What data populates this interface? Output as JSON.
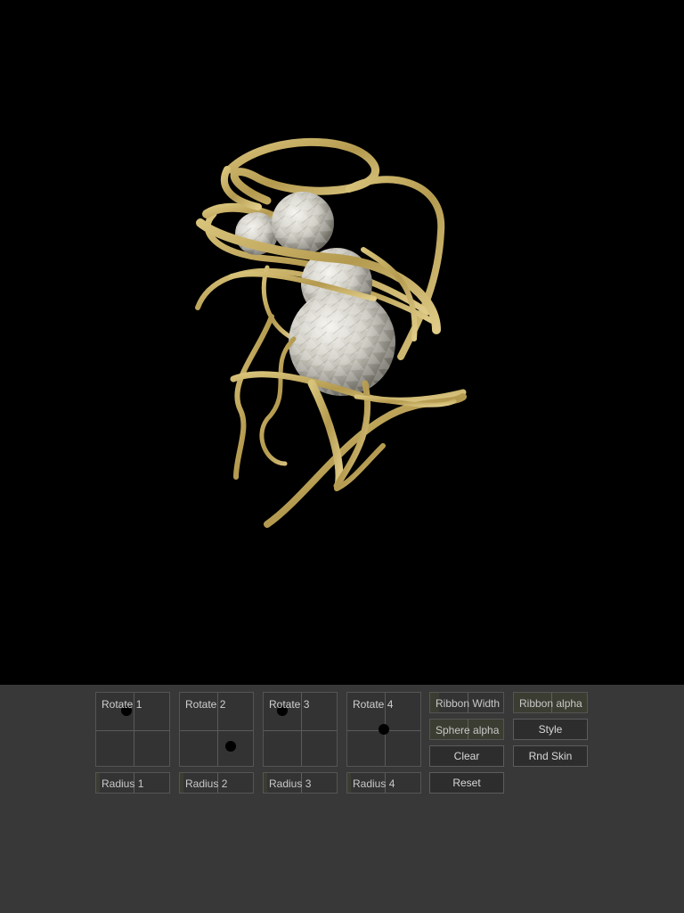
{
  "controls": {
    "pads": [
      {
        "label": "Rotate 1",
        "handle": [
          0.42,
          0.24
        ]
      },
      {
        "label": "Rotate 2",
        "handle": [
          0.7,
          0.73
        ]
      },
      {
        "label": "Rotate 3",
        "handle": [
          0.26,
          0.24
        ]
      },
      {
        "label": "Rotate 4",
        "handle": [
          0.5,
          0.5
        ]
      }
    ],
    "sliders": {
      "radius_1": {
        "label": "Radius 1",
        "value": 0.05
      },
      "radius_2": {
        "label": "Radius 2",
        "value": 0.05
      },
      "radius_3": {
        "label": "Radius 3",
        "value": 0.05
      },
      "radius_4": {
        "label": "Radius 4",
        "value": 0.05
      },
      "ribbon_width": {
        "label": "Ribbon Width",
        "value": 0.12
      },
      "ribbon_alpha": {
        "label": "Ribbon alpha",
        "value": 1.0
      },
      "sphere_alpha": {
        "label": "Sphere alpha",
        "value": 1.0
      }
    },
    "buttons": {
      "style": "Style",
      "clear": "Clear",
      "rnd_skin": "Rnd Skin",
      "reset": "Reset"
    }
  },
  "scene": {
    "background": "#000000",
    "ribbon_color": "#c9b368",
    "ribbon_shadow": "#8a7535",
    "sphere_color": "#d9d8d2"
  },
  "ui_colors": {
    "panel": "#383838",
    "border": "#555555",
    "text": "#cfcfcf"
  }
}
